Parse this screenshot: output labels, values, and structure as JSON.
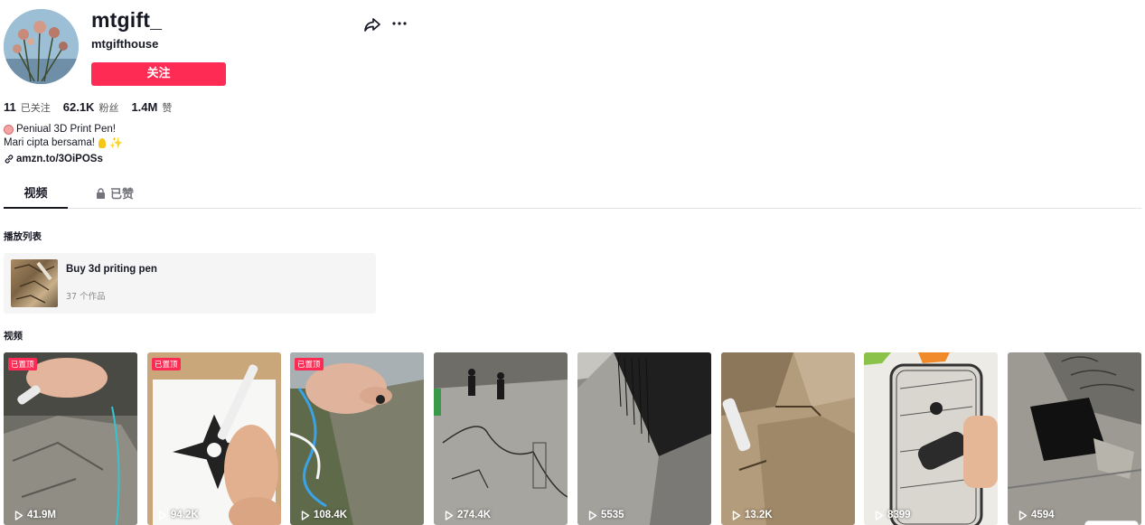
{
  "profile": {
    "username": "mtgift_",
    "nickname": "mtgifthouse",
    "follow_label": "关注"
  },
  "stats": [
    {
      "value": "11",
      "label": "已关注"
    },
    {
      "value": "62.1K",
      "label": "粉丝"
    },
    {
      "value": "1.4M",
      "label": "赞"
    }
  ],
  "bio": {
    "line1": "Peniual 3D Print Pen!",
    "line2": "Mari cipta bersama!",
    "link": "amzn.to/3OiPOSs"
  },
  "tabs": {
    "videos": "视频",
    "liked": "已赞"
  },
  "playlists": {
    "section_title": "播放列表",
    "item": {
      "title": "Buy 3d priting pen",
      "count": "37 个作品"
    }
  },
  "videos": {
    "section_title": "视频",
    "pinned_label": "已置顶",
    "items": [
      {
        "views": "41.9M",
        "pinned": true
      },
      {
        "views": "94.2K",
        "pinned": true
      },
      {
        "views": "108.4K",
        "pinned": true
      },
      {
        "views": "274.4K",
        "pinned": false
      },
      {
        "views": "5535",
        "pinned": false
      },
      {
        "views": "13.2K",
        "pinned": false
      },
      {
        "views": "8399",
        "pinned": false
      },
      {
        "views": "4594",
        "pinned": false
      }
    ]
  },
  "icons": {
    "share": "share-icon",
    "more": "more-icon",
    "link": "link-icon",
    "lock": "lock-icon",
    "play": "play-icon"
  },
  "colors": {
    "accent": "#fe2c55",
    "text": "#161823",
    "muted": "#73747b"
  }
}
